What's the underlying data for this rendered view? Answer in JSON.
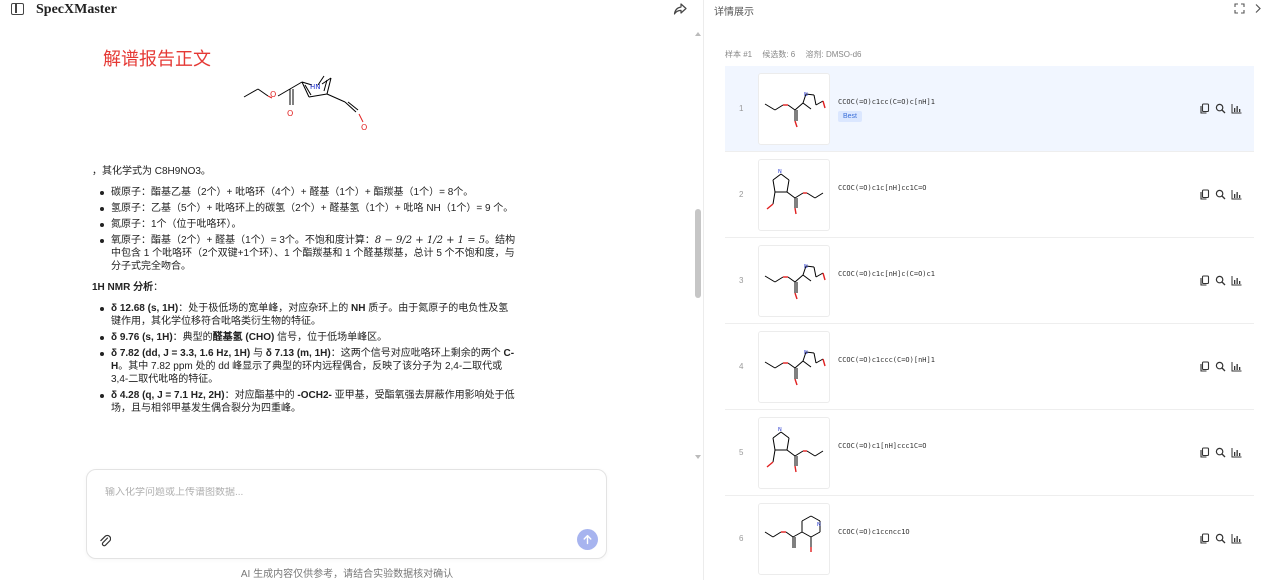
{
  "app": {
    "title": "SpecXMaster"
  },
  "chat": {
    "report_title": "解谱报告正文",
    "formula_line": "，其化学式为 C8H9NO3。",
    "atom_items": [
      "碳原子：酯基乙基（2个）+ 吡咯环（4个）+ 醛基（1个）+ 酯羰基（1个）= 8个。",
      "氢原子：乙基（5个）+ 吡咯环上的碳氢（2个）+ 醛基氢（1个）+ 吡咯 NH（1个）= 9 个。",
      "氮原子：1个（位于吡咯环）。"
    ],
    "oxygen_item": {
      "text_a": "氧原子：酯基（2个）+ 醛基（1个）= 3个。不饱和度计算：",
      "math": "8 − 9/2 + 1/2 + 1 = 5",
      "text_b": "。结构中包含 1 个吡咯环（2个双键+1个环）、1 个酯羰基和 1 个醛基羰基，总计 5 个不饱和度，与分子式完全吻合。"
    },
    "nmr_heading": "1H NMR 分析",
    "nmr_heading_suffix": "：",
    "nmr_items": [
      {
        "signal": "δ 12.68 (s, 1H)",
        "text_a": "：处于极低场的宽单峰，对应杂环上的 ",
        "bold": "NH",
        "text_b": " 质子。由于氮原子的电负性及氢键作用，其化学位移符合吡咯类衍生物的特征。"
      },
      {
        "signal": "δ 9.76 (s, 1H)",
        "text_a": "：典型的",
        "bold": "醛基氢 (CHO)",
        "text_b": " 信号，位于低场单峰区。"
      },
      {
        "signal": "δ 7.82 (dd, J = 3.3, 1.6 Hz, 1H)",
        "connector": " 与 ",
        "signal2": "δ 7.13 (m, 1H)",
        "text_a": "：这两个信号对应吡咯环上剩余的两个 ",
        "bold": "C-H",
        "text_b": "。其中 7.82 ppm 处的 dd 峰显示了典型的环内远程偶合，反映了该分子为 2,4-二取代或 3,4-二取代吡咯的特征。"
      },
      {
        "signal": "δ 4.28 (q, J = 7.1 Hz, 2H)",
        "text_a": "：对应酯基中的 ",
        "bold": "-OCH2-",
        "text_b": " 亚甲基，受酯氧强去屏蔽作用影响处于低场，且与相邻甲基发生偶合裂分为四重峰。"
      }
    ],
    "input_placeholder": "输入化学问题或上传谱图数据...",
    "disclaimer": "AI 生成内容仅供参考，请结合实验数据核对确认"
  },
  "panel": {
    "title": "详情展示",
    "meta": {
      "sample": "样本 #1",
      "candidates": "候选数: 6",
      "solvent": "溶剂: DMSO-d6"
    },
    "best_label": "Best",
    "candidates": [
      {
        "index": "1",
        "smiles": "CCOC(=O)c1cc(C=O)c[nH]1",
        "variant": "a"
      },
      {
        "index": "2",
        "smiles": "CCOC(=O)c1c[nH]cc1C=O",
        "variant": "b"
      },
      {
        "index": "3",
        "smiles": "CCOC(=O)c1c[nH]c(C=O)c1",
        "variant": "a"
      },
      {
        "index": "4",
        "smiles": "CCOC(=O)c1ccc(C=O)[nH]1",
        "variant": "a"
      },
      {
        "index": "5",
        "smiles": "CCOC(=O)c1[nH]ccc1C=O",
        "variant": "b"
      },
      {
        "index": "6",
        "smiles": "CCOC(=O)c1ccncc1O",
        "variant": "c"
      }
    ]
  },
  "colors": {
    "accent_red": "#e53935",
    "send_button": "#a7b4ef",
    "best_row": "#f1f6ff",
    "best_badge_text": "#3b6fd8",
    "oxygen": "#e02020",
    "nitrogen": "#2233cc"
  },
  "icons": {
    "sidebar": "sidebar-toggle-icon",
    "share": "share-icon",
    "attach": "paperclip-icon",
    "send": "arrow-up-icon",
    "expand": "fullscreen-icon",
    "collapse": "chevron-right-icon",
    "copy": "copy-icon",
    "search": "search-icon",
    "spectrum": "bar-chart-icon"
  }
}
